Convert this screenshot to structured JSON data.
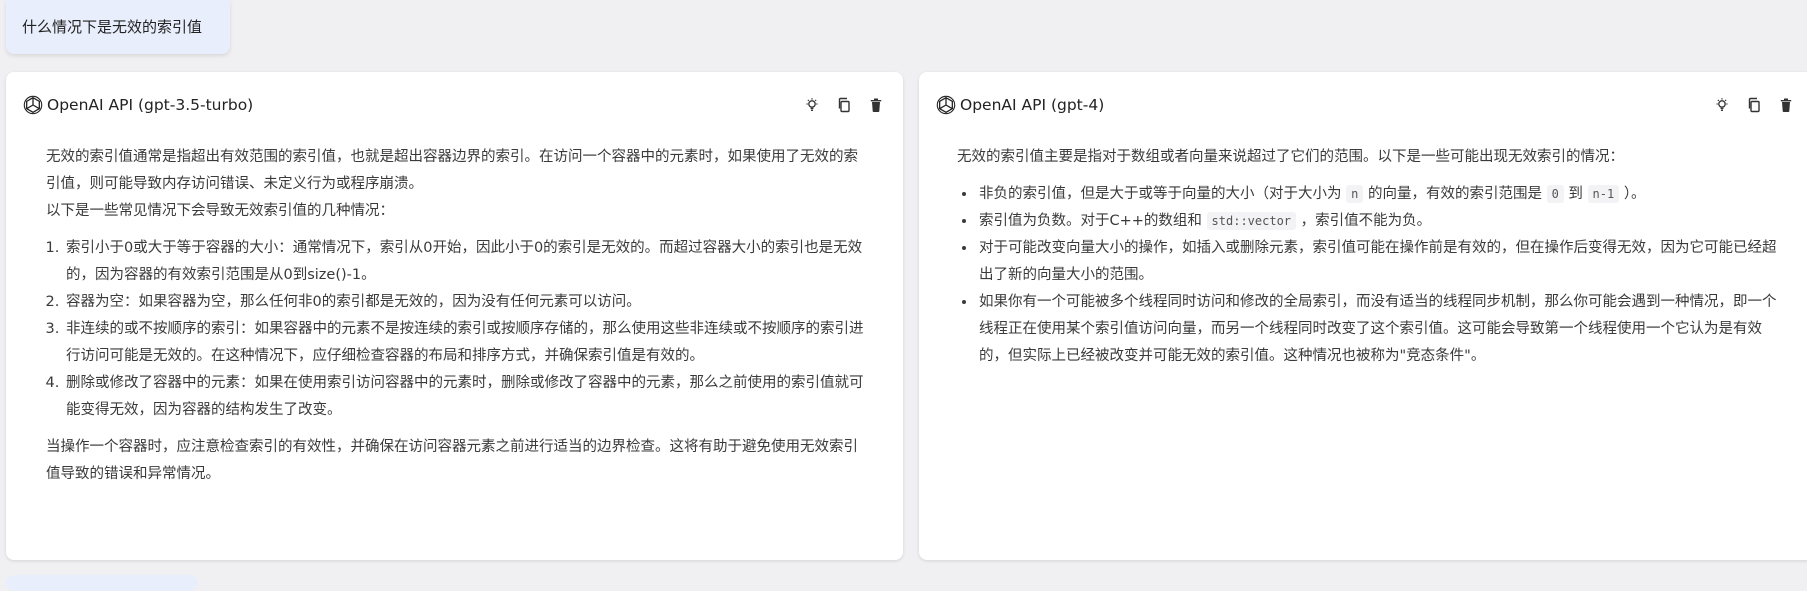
{
  "question": {
    "text": "什么情况下是无效的索引值"
  },
  "left": {
    "model_title": "OpenAI API (gpt-3.5-turbo)",
    "intro": "无效的索引值通常是指超出有效范围的索引值，也就是超出容器边界的索引。在访问一个容器中的元素时，如果使用了无效的索引值，则可能导致内存访问错误、未定义行为或程序崩溃。",
    "intro2": "以下是一些常见情况下会导致无效索引值的几种情况：",
    "items": [
      "索引小于0或大于等于容器的大小：通常情况下，索引从0开始，因此小于0的索引是无效的。而超过容器大小的索引也是无效的，因为容器的有效索引范围是从0到size()-1。",
      "容器为空：如果容器为空，那么任何非0的索引都是无效的，因为没有任何元素可以访问。",
      "非连续的或不按顺序的索引：如果容器中的元素不是按连续的索引或按顺序存储的，那么使用这些非连续或不按顺序的索引进行访问可能是无效的。在这种情况下，应仔细检查容器的布局和排序方式，并确保索引值是有效的。",
      "删除或修改了容器中的元素：如果在使用索引访问容器中的元素时，删除或修改了容器中的元素，那么之前使用的索引值就可能变得无效，因为容器的结构发生了改变。"
    ],
    "outro": "当操作一个容器时，应注意检查索引的有效性，并确保在访问容器元素之前进行适当的边界检查。这将有助于避免使用无效索引值导致的错误和异常情况。"
  },
  "right": {
    "model_title": "OpenAI API (gpt-4)",
    "intro": "无效的索引值主要是指对于数组或者向量来说超过了它们的范围。以下是一些可能出现无效索引的情况：",
    "item1_a": "非负的索引值，但是大于或等于向量的大小（对于大小为",
    "item1_code1": "n",
    "item1_b": "的向量，有效的索引范围是",
    "item1_code2": "0",
    "item1_c": "到",
    "item1_code3": "n-1",
    "item1_d": "）。",
    "item2_a": "索引值为负数。对于C++的数组和",
    "item2_code": "std::vector",
    "item2_b": "，索引值不能为负。",
    "item3": "对于可能改变向量大小的操作，如插入或删除元素，索引值可能在操作前是有效的，但在操作后变得无效，因为它可能已经超出了新的向量大小的范围。",
    "item4": "如果你有一个可能被多个线程同时访问和修改的全局索引，而没有适当的线程同步机制，那么你可能会遇到一种情况，即一个线程正在使用某个索引值访问向量，而另一个线程同时改变了这个索引值。这可能会导致第一个线程使用一个它认为是有效的，但实际上已经被改变并可能无效的索引值。这种情况也被称为\"竞态条件\"。"
  },
  "icons": [
    "openai-logo-icon",
    "bulb-icon",
    "copy-icon",
    "trash-icon"
  ]
}
